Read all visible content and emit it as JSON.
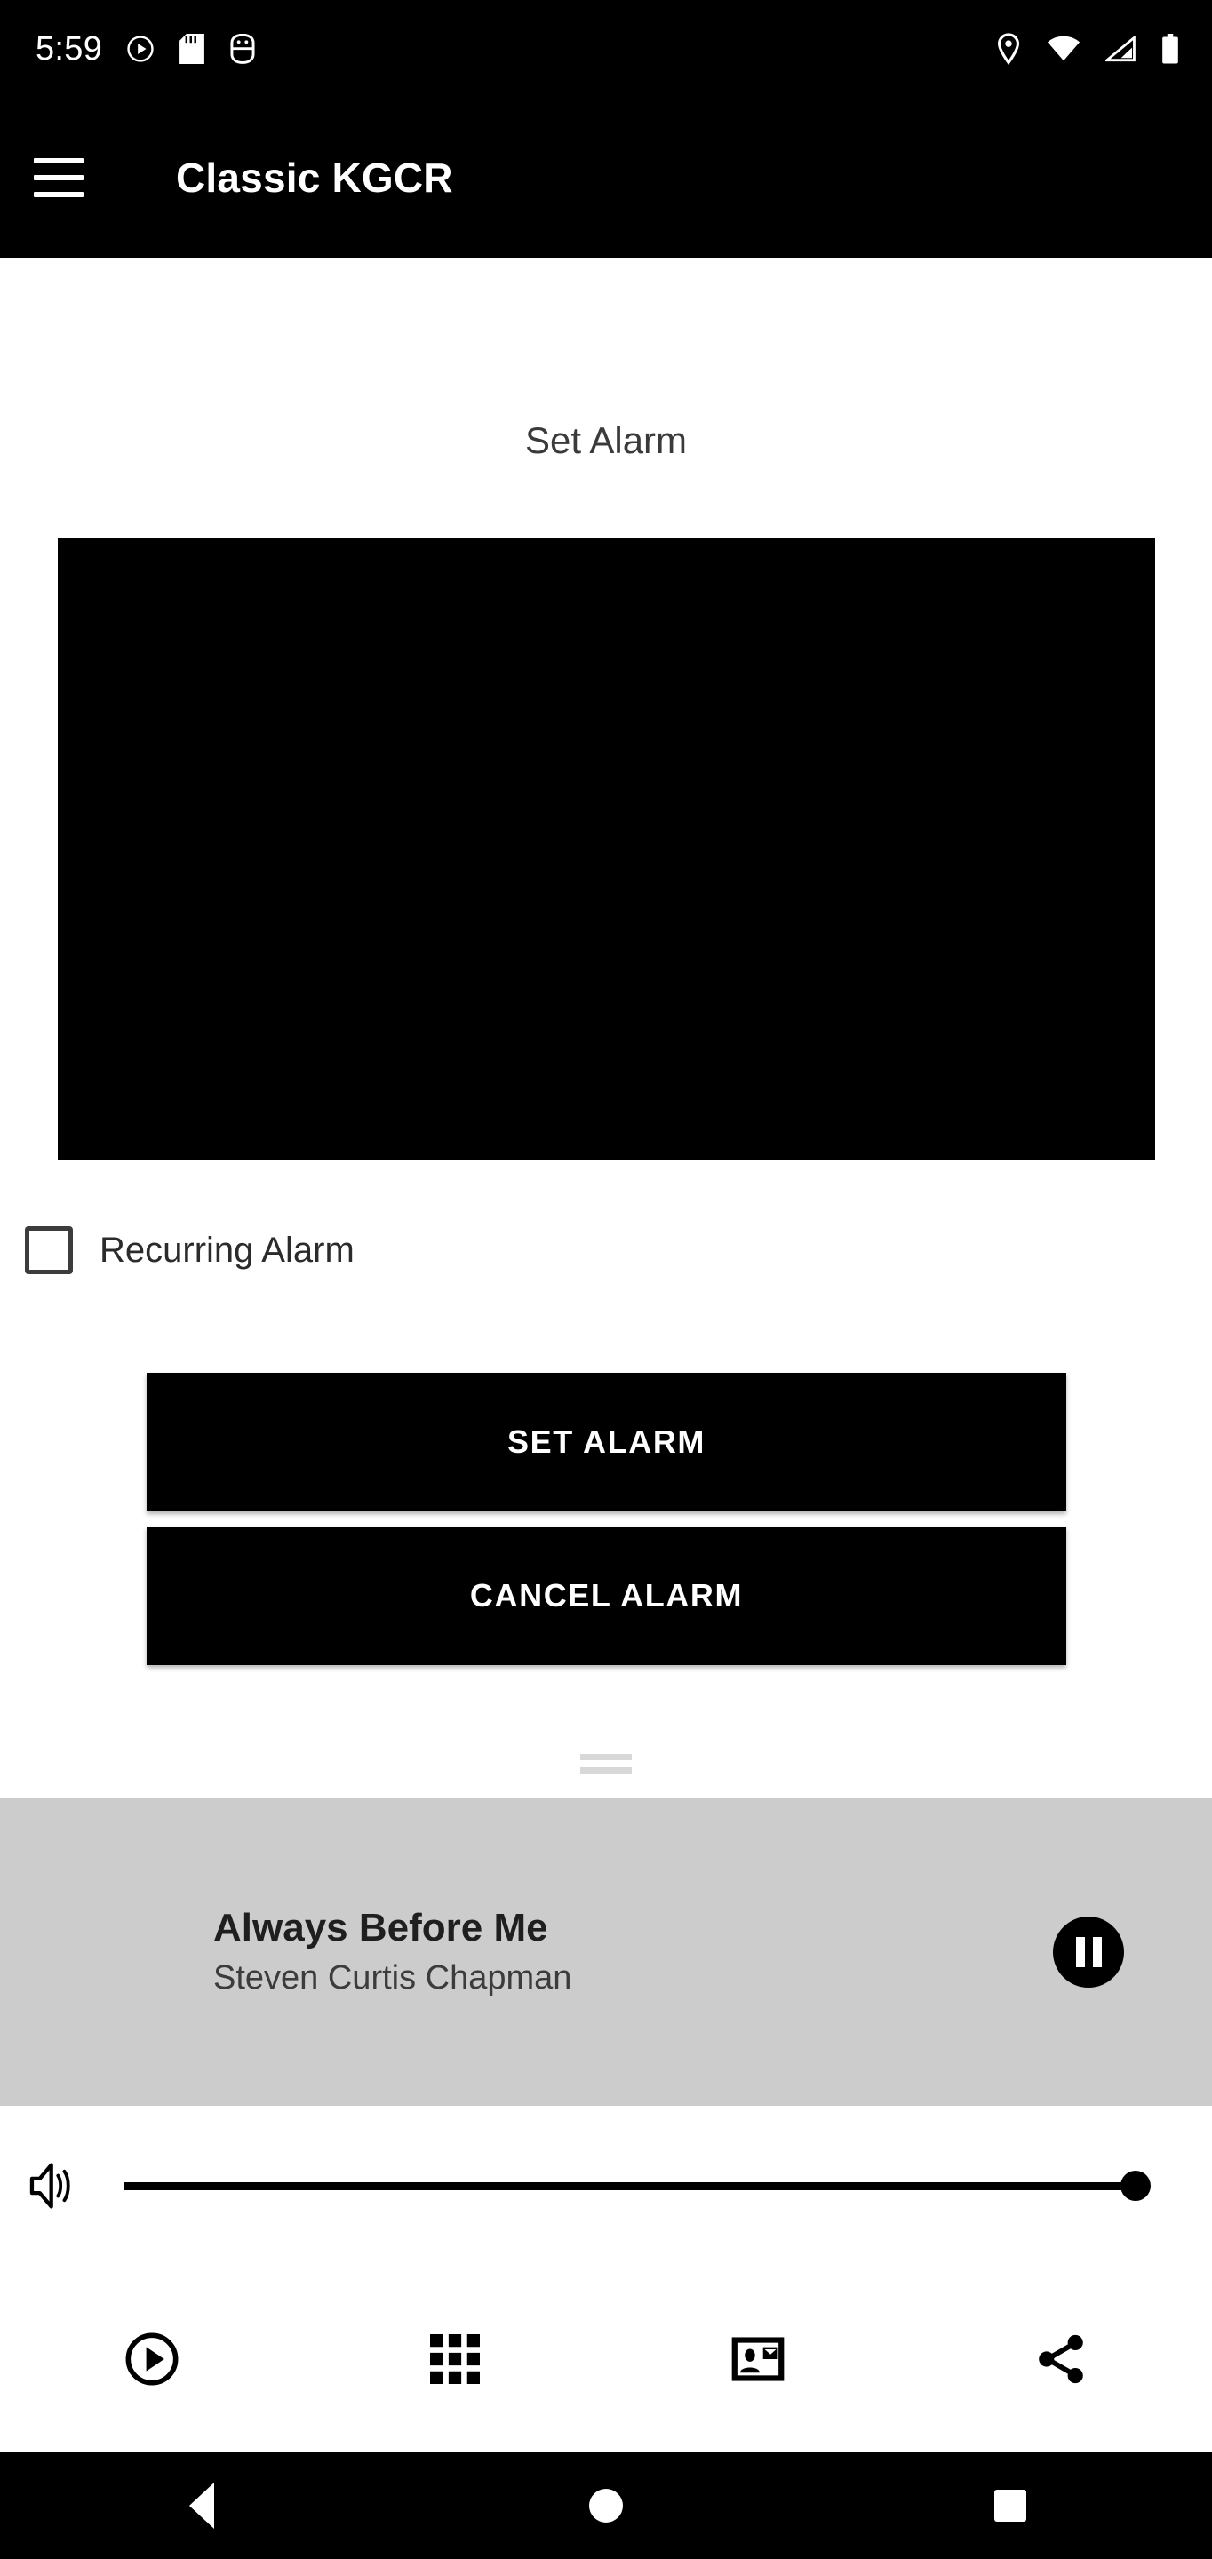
{
  "status_bar": {
    "clock": "5:59",
    "left_icons": [
      "play-circle-icon",
      "sd-card-icon",
      "android-debug-icon"
    ],
    "right_icons": [
      "location-pin-icon",
      "wifi-icon",
      "cellular-signal-icon",
      "battery-icon"
    ],
    "background_color": "#000000",
    "foreground_color": "#ffffff"
  },
  "app_bar": {
    "menu_icon": "hamburger-menu-icon",
    "title": "Classic KGCR",
    "background_color": "#000000",
    "title_color": "#ffffff"
  },
  "main": {
    "section_title": "Set Alarm",
    "time_picker": {
      "label": "alarm-time-picker",
      "background_color": "#000000"
    },
    "recurring": {
      "label": "Recurring Alarm",
      "checked": false
    },
    "buttons": [
      {
        "label": "SET ALARM",
        "name": "set-alarm-button"
      },
      {
        "label": "CANCEL ALARM",
        "name": "cancel-alarm-button"
      }
    ]
  },
  "now_playing": {
    "track_title": "Always Before Me",
    "track_artist": "Steven Curtis Chapman",
    "transport_icon": "pause-icon",
    "state": "playing",
    "background_color": "#cccccc"
  },
  "volume": {
    "icon": "volume-up-icon",
    "value": 100,
    "min": 0,
    "max": 100
  },
  "action_bar": {
    "items": [
      {
        "name": "play-circle-icon",
        "label": "Play"
      },
      {
        "name": "grid-apps-icon",
        "label": "Grid"
      },
      {
        "name": "contact-mail-icon",
        "label": "Contact"
      },
      {
        "name": "share-icon",
        "label": "Share"
      }
    ]
  },
  "nav_bar": {
    "back": "back-triangle-icon",
    "home": "home-circle-icon",
    "recents": "recents-square-icon",
    "background_color": "#000000"
  }
}
